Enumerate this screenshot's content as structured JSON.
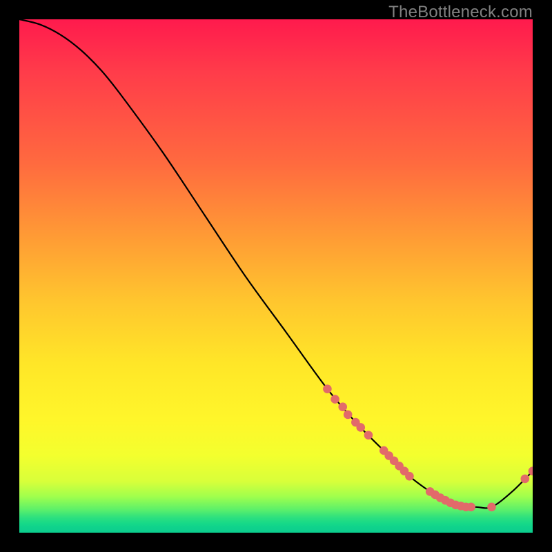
{
  "watermark": "TheBottleneck.com",
  "chart_data": {
    "type": "line",
    "title": "",
    "xlabel": "",
    "ylabel": "",
    "xlim": [
      0,
      100
    ],
    "ylim": [
      0,
      100
    ],
    "curve": {
      "x": [
        0,
        4,
        8,
        12,
        16,
        20,
        28,
        36,
        44,
        52,
        60,
        66,
        72,
        76,
        80,
        83,
        86,
        89,
        92,
        96,
        100
      ],
      "y": [
        100,
        99,
        97,
        94,
        90,
        85,
        74,
        62,
        50,
        39,
        28,
        21,
        15,
        11,
        8,
        6,
        5,
        5,
        5,
        8,
        12
      ]
    },
    "markers": [
      {
        "x": 60.0,
        "y": 28.0
      },
      {
        "x": 61.5,
        "y": 26.0
      },
      {
        "x": 63.0,
        "y": 24.5
      },
      {
        "x": 64.0,
        "y": 23.0
      },
      {
        "x": 65.5,
        "y": 21.5
      },
      {
        "x": 66.5,
        "y": 20.5
      },
      {
        "x": 68.0,
        "y": 19.0
      },
      {
        "x": 71.0,
        "y": 16.0
      },
      {
        "x": 72.0,
        "y": 15.0
      },
      {
        "x": 73.0,
        "y": 14.0
      },
      {
        "x": 74.0,
        "y": 13.0
      },
      {
        "x": 75.0,
        "y": 12.0
      },
      {
        "x": 76.0,
        "y": 11.0
      },
      {
        "x": 80.0,
        "y": 8.0
      },
      {
        "x": 81.0,
        "y": 7.4
      },
      {
        "x": 82.0,
        "y": 6.8
      },
      {
        "x": 83.0,
        "y": 6.3
      },
      {
        "x": 84.0,
        "y": 5.8
      },
      {
        "x": 85.0,
        "y": 5.4
      },
      {
        "x": 86.0,
        "y": 5.2
      },
      {
        "x": 87.0,
        "y": 5.0
      },
      {
        "x": 88.0,
        "y": 5.0
      },
      {
        "x": 92.0,
        "y": 5.0
      },
      {
        "x": 98.5,
        "y": 10.5
      },
      {
        "x": 100.0,
        "y": 12.0
      }
    ],
    "marker_color": "#e26a6a",
    "curve_color": "#000000"
  }
}
